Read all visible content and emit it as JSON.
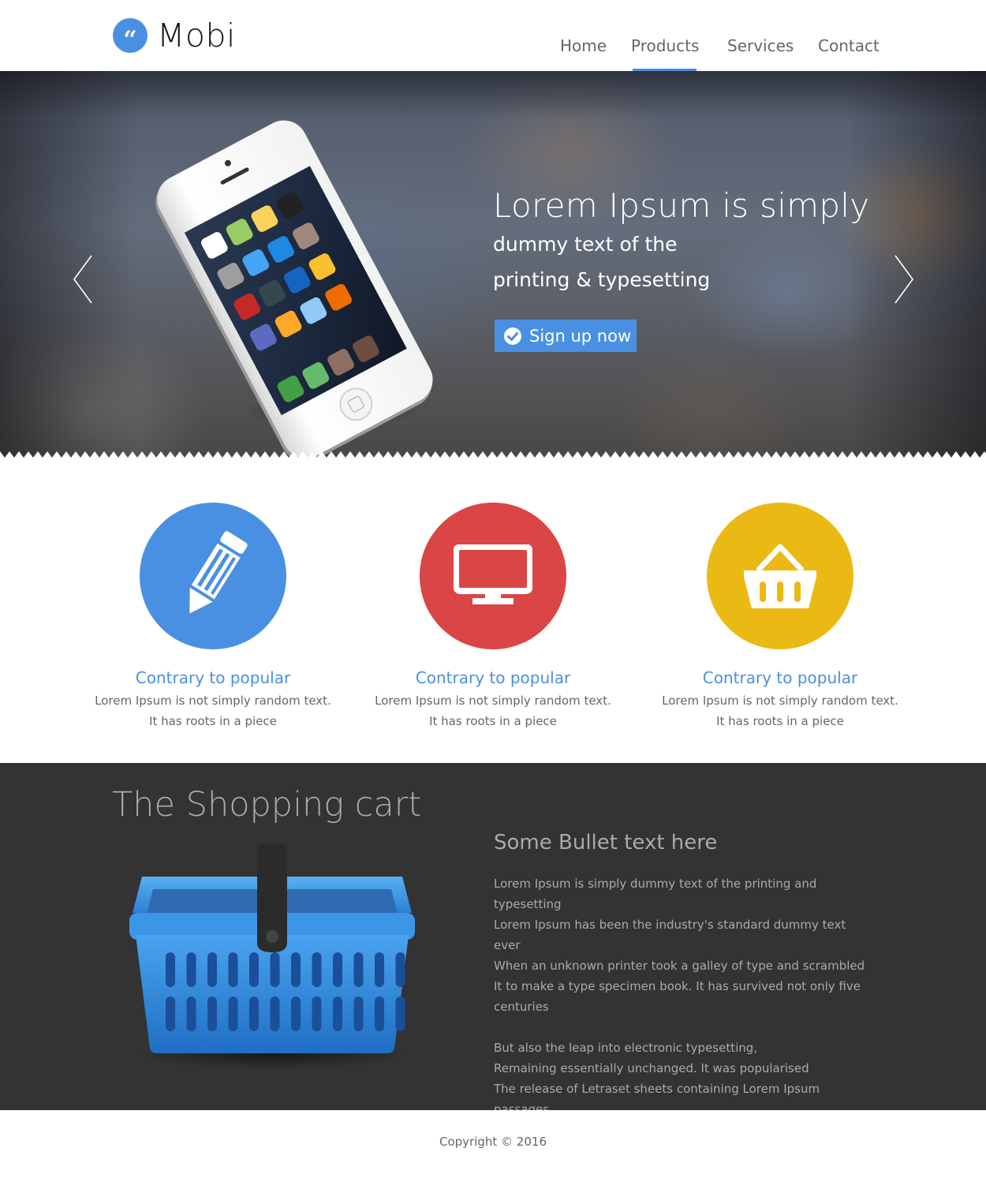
{
  "header": {
    "logo_text": "Mobi",
    "logo_glyph": "“",
    "logo_icon": "quote-icon",
    "nav": [
      {
        "label": "Home"
      },
      {
        "label": "Products",
        "active": true
      },
      {
        "label": "Services"
      },
      {
        "label": "Contact"
      }
    ]
  },
  "hero": {
    "title": "Lorem Ipsum is simply",
    "subtitle_line1": "dummy text of the",
    "subtitle_line2": "printing & typesetting",
    "cta_label": "Sign up now",
    "cta_icon": "check-circle-icon",
    "prev_icon": "chevron-left-icon",
    "next_icon": "chevron-right-icon",
    "phone_image": "iphone-image"
  },
  "features": [
    {
      "icon": "pencil-icon",
      "color": "#4a90e2",
      "title": "Contrary to popular",
      "text": "Lorem Ipsum is not simply random text. It has roots in a piece"
    },
    {
      "icon": "monitor-icon",
      "color": "#da4545",
      "title": "Contrary to popular",
      "text": "Lorem Ipsum is not simply random text. It has roots in a piece"
    },
    {
      "icon": "basket-icon",
      "color": "#ebb913",
      "title": "Contrary to popular",
      "text": "Lorem Ipsum is not simply random text. It has roots in a piece"
    }
  ],
  "cart_section": {
    "title": "The Shopping cart",
    "bullet_title": "Some Bullet text here",
    "paragraph1": [
      "Lorem Ipsum is simply dummy text of the printing and typesetting",
      "Lorem Ipsum has been the industry's standard dummy text ever",
      "When an unknown printer took a galley of type and scrambled",
      "It to make a type specimen book. It has survived not only five",
      "centuries"
    ],
    "paragraph2": [
      "But also the leap into electronic typesetting,",
      "Remaining essentially unchanged. It was popularised",
      "The release of Letraset sheets containing Lorem Ipsum passages"
    ],
    "image": "shopping-basket-image"
  },
  "footer": {
    "copyright": "Copyright © 2016"
  },
  "colors": {
    "accent": "#4a90e2",
    "red": "#da4545",
    "yellow": "#ebb913",
    "dark_bg": "#333333"
  }
}
